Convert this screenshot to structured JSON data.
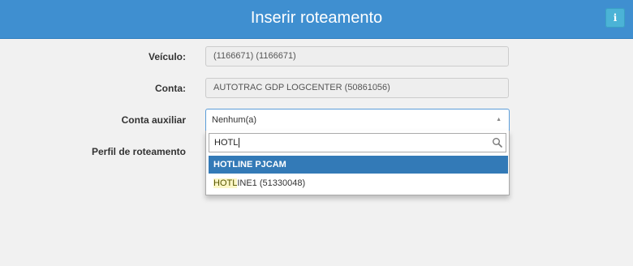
{
  "header": {
    "title": "Inserir roteamento",
    "info_icon": "info-icon",
    "info_glyph": "i",
    "color": "#3f8fd0"
  },
  "form": {
    "veiculo": {
      "label": "Veículo:",
      "value": "(1166671) (1166671)"
    },
    "conta": {
      "label": "Conta:",
      "value": "AUTOTRAC GDP LOGCENTER (50861056)"
    },
    "conta_auxiliar": {
      "label": "Conta auxiliar",
      "selected": "Nenhum(a)"
    },
    "perfil": {
      "label": "Perfil de roteamento"
    }
  },
  "dropdown": {
    "search_value": "HOTL",
    "search_icon": "search-icon",
    "options": [
      {
        "label": "HOTLINE PJCAM",
        "highlighted": true
      },
      {
        "match": "HOTL",
        "rest": "INE1 (51330048)",
        "highlighted": false
      }
    ],
    "highlight_color": "#337ab7"
  }
}
